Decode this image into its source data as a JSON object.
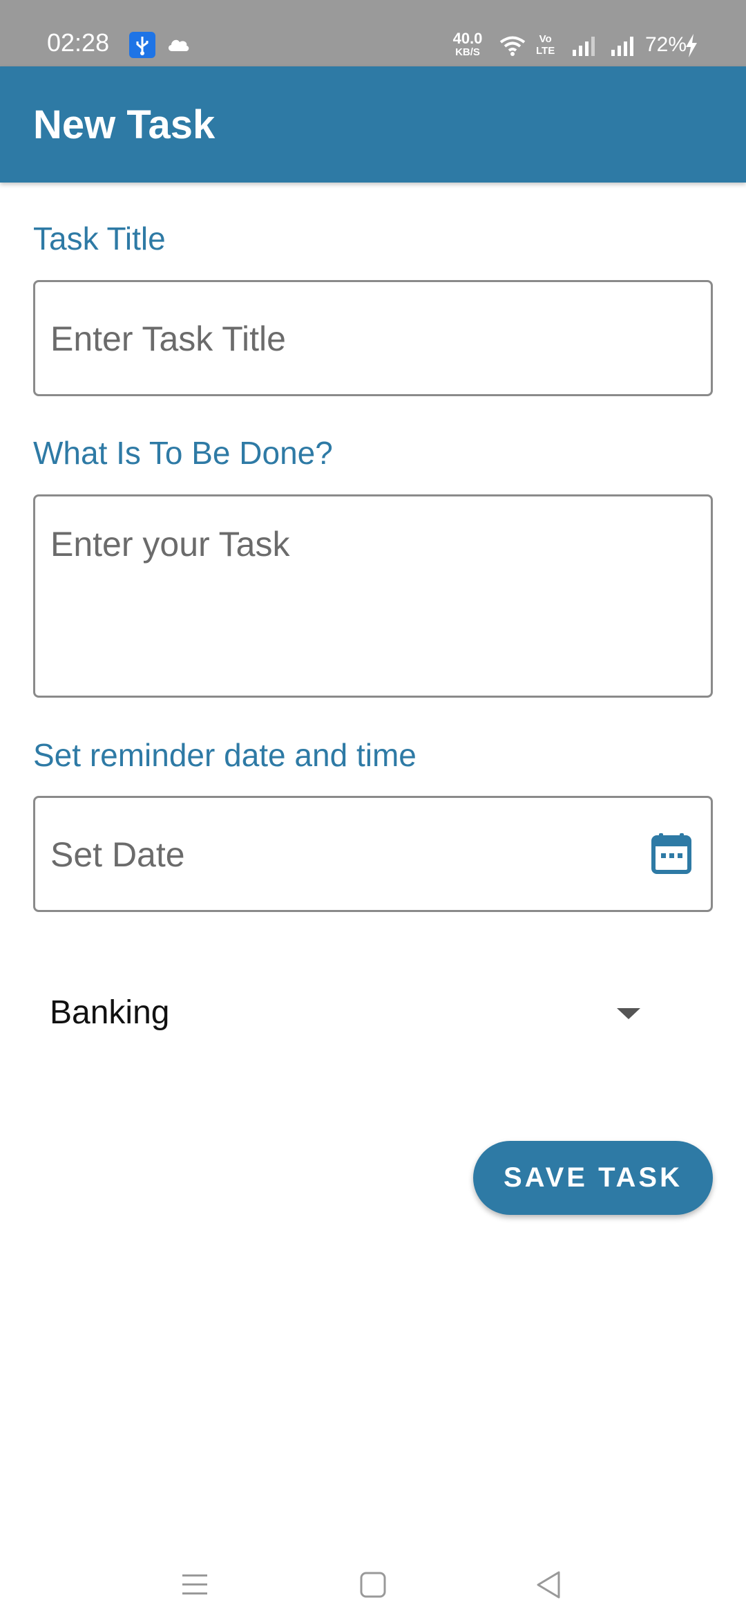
{
  "status_bar": {
    "time": "02:28",
    "net_speed_value": "40.0",
    "net_speed_unit": "KB/S",
    "volte_line1": "Vo",
    "volte_line2": "LTE",
    "battery": "72%",
    "icons": [
      "usb-icon",
      "cloud-icon",
      "wifi-icon",
      "volte-icon",
      "signal-icon",
      "signal-icon",
      "charging-bolt-icon"
    ]
  },
  "app_bar": {
    "title": "New Task",
    "color": "#2e7aa5"
  },
  "form": {
    "title_label": "Task Title",
    "title_placeholder": "Enter Task Title",
    "task_label": "What Is To Be Done?",
    "task_placeholder": "Enter your Task",
    "reminder_label": "Set reminder date and time",
    "date_placeholder": "Set Date",
    "date_icon": "calendar-icon",
    "category_selected": "Banking",
    "save_button": "SAVE TASK"
  },
  "nav_bar": {
    "icons": [
      "menu-icon",
      "home-square-icon",
      "back-triangle-icon"
    ]
  },
  "colors": {
    "accent": "#2e7aa5",
    "status_bar": "#9a9a9a",
    "placeholder": "#6b6b6b",
    "border": "#8a8a8a"
  }
}
